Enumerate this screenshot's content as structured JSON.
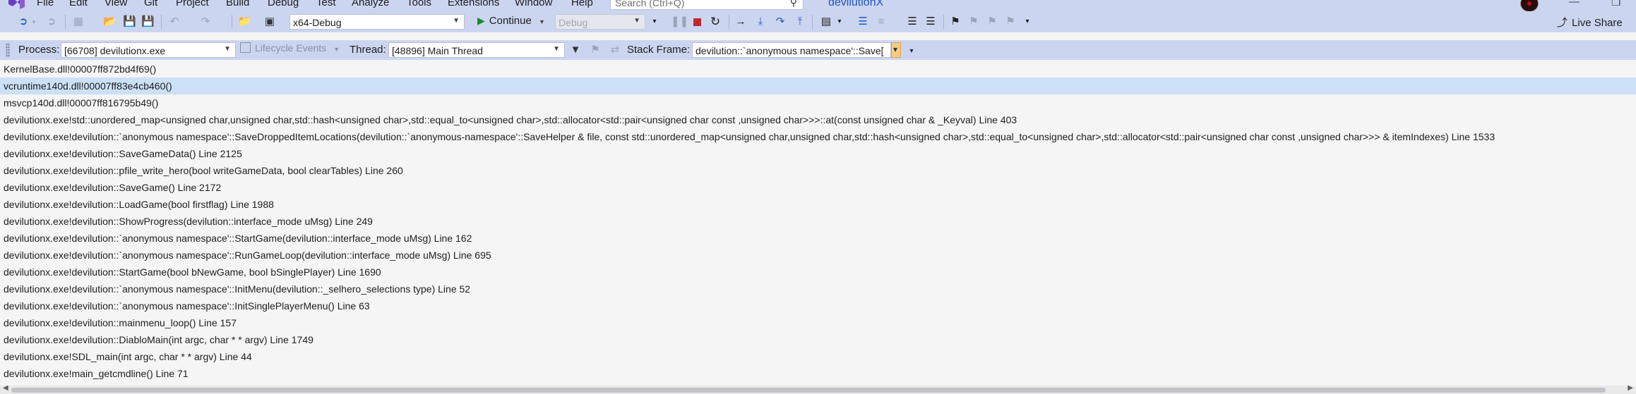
{
  "menubar": {
    "items": [
      "File",
      "Edit",
      "View",
      "Git",
      "Project",
      "Build",
      "Debug",
      "Test",
      "Analyze",
      "Tools",
      "Extensions",
      "Window",
      "Help"
    ],
    "search_placeholder": "Search (Ctrl+Q)",
    "solution_name": "devilutionX"
  },
  "toolbar": {
    "configuration": "x64-Debug",
    "continue_label": "Continue",
    "debug_target": "Debug",
    "live_share_label": "Live Share"
  },
  "location_bar": {
    "process_label": "Process:",
    "process_value": "[66708] devilutionx.exe",
    "lifecycle_label": "Lifecycle Events",
    "thread_label": "Thread:",
    "thread_value": "[48896] Main Thread",
    "stack_frame_label": "Stack Frame:",
    "stack_frame_value": "devilution::`anonymous namespace'::Save["
  },
  "call_stack": {
    "selected_index": 1,
    "frames": [
      "KernelBase.dll!00007ff872bd4f69()",
      "vcruntime140d.dll!00007ff83e4cb460()",
      "msvcp140d.dll!00007ff816795b49()",
      "devilutionx.exe!std::unordered_map<unsigned char,unsigned char,std::hash<unsigned char>,std::equal_to<unsigned char>,std::allocator<std::pair<unsigned char const ,unsigned char>>>::at(const unsigned char & _Keyval) Line 403",
      "devilutionx.exe!devilution::`anonymous namespace'::SaveDroppedItemLocations(devilution::`anonymous-namespace'::SaveHelper & file, const std::unordered_map<unsigned char,unsigned char,std::hash<unsigned char>,std::equal_to<unsigned char>,std::allocator<std::pair<unsigned char const ,unsigned char>>> & itemIndexes) Line 1533",
      "devilutionx.exe!devilution::SaveGameData() Line 2125",
      "devilutionx.exe!devilution::pfile_write_hero(bool writeGameData, bool clearTables) Line 260",
      "devilutionx.exe!devilution::SaveGame() Line 2172",
      "devilutionx.exe!devilution::LoadGame(bool firstflag) Line 1988",
      "devilutionx.exe!devilution::ShowProgress(devilution::interface_mode uMsg) Line 249",
      "devilutionx.exe!devilution::`anonymous namespace'::StartGame(devilution::interface_mode uMsg) Line 162",
      "devilutionx.exe!devilution::`anonymous namespace'::RunGameLoop(devilution::interface_mode uMsg) Line 695",
      "devilutionx.exe!devilution::StartGame(bool bNewGame, bool bSinglePlayer) Line 1690",
      "devilutionx.exe!devilution::`anonymous namespace'::InitMenu(devilution::_selhero_selections type) Line 52",
      "devilutionx.exe!devilution::`anonymous namespace'::InitSinglePlayerMenu() Line 63",
      "devilutionx.exe!devilution::mainmenu_loop() Line 157",
      "devilutionx.exe!devilution::DiabloMain(int argc, char * * argv) Line 1749",
      "devilutionx.exe!SDL_main(int argc, char * * argv) Line 44",
      "devilutionx.exe!main_getcmdline() Line 71"
    ]
  }
}
